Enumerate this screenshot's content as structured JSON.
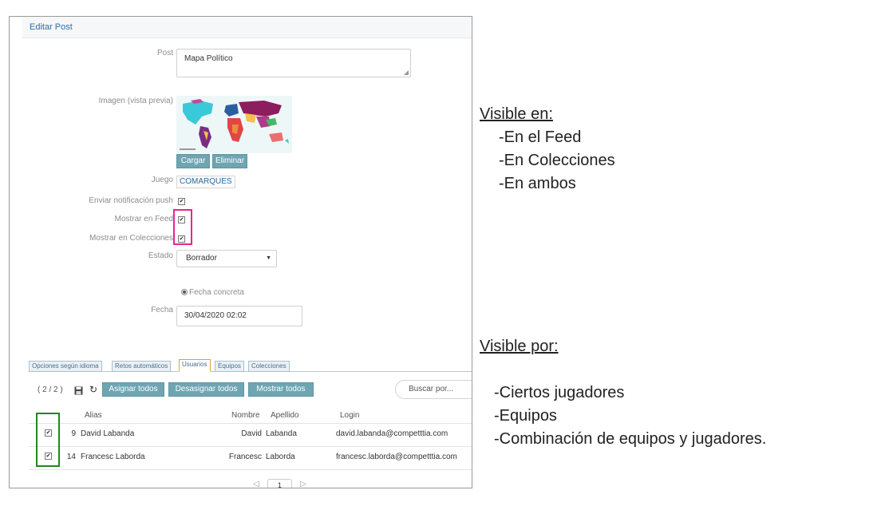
{
  "form": {
    "title": "Editar Post",
    "post_label": "Post",
    "post_value": "Mapa Político",
    "image_label": "Imagen (vista previa)",
    "upload_button": "Cargar",
    "delete_button": "Eliminar",
    "game_label": "Juego",
    "game_value": "COMARQUES",
    "push_label": "Enviar notificación push",
    "feed_label": "Mostrar en Feed",
    "collections_label": "Mostrar en Colecciones",
    "status_label": "Estado",
    "status_value": "Borrador",
    "radio_label": "Fecha concreta",
    "date_label": "Fecha",
    "date_value": "30/04/2020 02:02"
  },
  "tabs": [
    {
      "label": "Opciones según idioma"
    },
    {
      "label": "Retos automáticos"
    },
    {
      "label": "Usuarios"
    },
    {
      "label": "Equipos"
    },
    {
      "label": "Colecciones"
    }
  ],
  "toolbar": {
    "count": "( 2 / 2 )",
    "assign_all": "Asignar todos",
    "unassign_all": "Desasignar todos",
    "show_all": "Mostrar todos",
    "search_placeholder": "Buscar por..."
  },
  "table": {
    "headers": [
      "Alias",
      "Nombre",
      "Apellido",
      "Login"
    ],
    "rows": [
      {
        "id": "9",
        "alias": "David Labanda",
        "nombre": "David",
        "apellido": "Labanda",
        "login": "david.labanda@competttia.com"
      },
      {
        "id": "14",
        "alias": "Francesc Laborda",
        "nombre": "Francesc",
        "apellido": "Laborda",
        "login": "francesc.laborda@competttia.com"
      }
    ]
  },
  "pagination": {
    "page": "1"
  },
  "annotations": {
    "visible_en_title": "Visible en:",
    "visible_en_items": [
      "-En el Feed",
      "-En Colecciones",
      "-En ambos"
    ],
    "visible_por_title": "Visible por:",
    "visible_por_items": [
      "-Ciertos jugadores",
      "-Equipos",
      "-Combinación de equipos y jugadores."
    ]
  },
  "colors": {
    "accent_button": "#6fa5b3",
    "feed_highlight": "#e8258b",
    "row_highlight": "#20891f",
    "link": "#2a6fa8"
  }
}
